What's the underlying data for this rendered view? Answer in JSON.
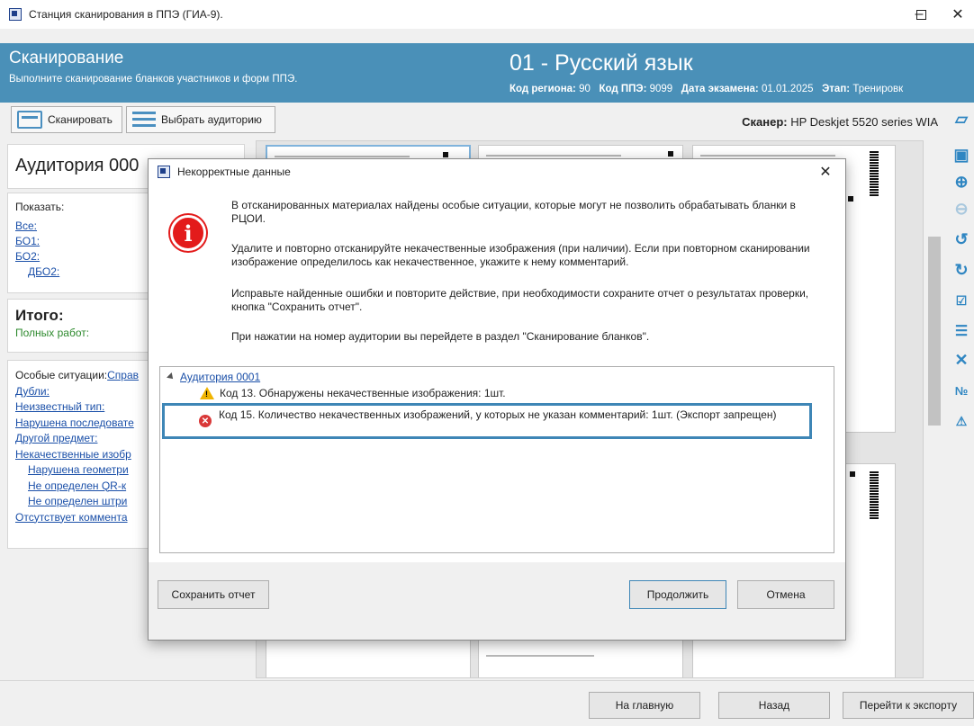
{
  "window": {
    "title": "Станция сканирования в ППЭ (ГИА-9)."
  },
  "header": {
    "title": "Сканирование",
    "subtitle": "Выполните сканирование бланков участников и форм ППЭ.",
    "subject": "01 - Русский язык",
    "region_label": "Код региона:",
    "region_value": "90",
    "ppe_label": "Код ППЭ:",
    "ppe_value": "9099",
    "date_label": "Дата экзамена:",
    "date_value": "01.01.2025",
    "stage_label": "Этап:",
    "stage_value": "Тренировк"
  },
  "toolbar": {
    "scan_label": "Сканировать",
    "select_aud_label": "Выбрать аудиторию",
    "scanner_label": "Сканер:",
    "scanner_value": "HP Deskjet 5520 series WIA"
  },
  "left": {
    "auditorium": "Аудитория 000",
    "show_label": "Показать:",
    "show_links": [
      "Все:",
      "БО1:",
      "БО2:",
      "ДБО2:"
    ],
    "total_title": "Итого:",
    "total_full": "Полных работ:",
    "special_label": "Особые ситуации:",
    "special_link": "Справ",
    "special_items": [
      "Дубли:",
      "Неизвестный тип:",
      "Нарушена последовате",
      "Другой предмет:",
      "Некачественные изобр",
      "Нарушена геометри",
      "Не определен QR-к",
      "Не определен штри",
      "Отсутствует коммента"
    ]
  },
  "dialog": {
    "title": "Некорректные данные",
    "p1": "В отсканированных материалах найдены особые ситуации, которые могут не позволить обрабатывать бланки в РЦОИ.",
    "p2": "Удалите и повторно отсканируйте некачественные изображения (при наличии). Если при повторном сканировании изображение определилось как некачественное, укажите к нему комментарий.",
    "p3": "Исправьте найденные ошибки и повторите действие, при необходимости сохраните отчет  о результатах проверки, кнопка \"Сохранить отчет\".",
    "p4": "При нажатии на номер аудитории вы перейдете в раздел \"Сканирование бланков\".",
    "tree_root": "Аудитория 0001",
    "item1": "Код 13. Обнаружены некачественные изображения: 1шт.",
    "item2": "Код 15. Количество некачественных изображений, у которых не указан комментарий: 1шт. (Экспорт запрещен)",
    "save_report": "Сохранить отчет",
    "continue": "Продолжить",
    "cancel": "Отмена"
  },
  "bottom": {
    "home": "На главную",
    "back": "Назад",
    "export": "Перейти к экспорту"
  },
  "colors": {
    "header_bg": "#4a90b8",
    "accent": "#2f86c2",
    "error": "#e31b1b",
    "warning": "#f0b400"
  }
}
